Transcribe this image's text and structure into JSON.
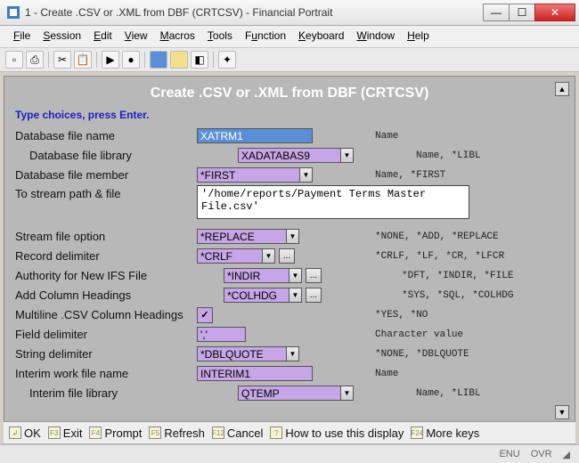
{
  "window": {
    "title": "1 - Create .CSV or .XML from DBF (CRTCSV) - Financial Portrait"
  },
  "menu": {
    "items": [
      "File",
      "Session",
      "Edit",
      "View",
      "Macros",
      "Tools",
      "Function",
      "Keyboard",
      "Window",
      "Help"
    ]
  },
  "screen": {
    "heading": "Create .CSV or .XML from DBF (CRTCSV)",
    "prompt": "Type choices, press Enter."
  },
  "fields": {
    "db_file": {
      "label": "Database file name",
      "value": "XATRM1",
      "hint": "Name"
    },
    "db_lib": {
      "label": "Database file library",
      "value": "XADATABAS9",
      "hint": "Name, *LIBL"
    },
    "db_mbr": {
      "label": "Database file member",
      "value": "*FIRST",
      "hint": "Name, *FIRST"
    },
    "path": {
      "label": "To stream path & file",
      "value": "'/home/reports/Payment Terms Master File.csv'"
    },
    "stmf": {
      "label": "Stream file option",
      "value": "*REPLACE",
      "hint": "*NONE, *ADD, *REPLACE"
    },
    "rcddlm": {
      "label": "Record delimiter",
      "value": "*CRLF",
      "hint": "*CRLF, *LF, *CR, *LFCR"
    },
    "auth": {
      "label": "Authority for New IFS File",
      "value": "*INDIR",
      "hint": "*DFT, *INDIR, *FILE"
    },
    "colhdg": {
      "label": "Add Column Headings",
      "value": "*COLHDG",
      "hint": "*SYS, *SQL, *COLHDG"
    },
    "mline": {
      "label": "Multiline .CSV Column Headings",
      "checked": "✓",
      "hint": "*YES, *NO"
    },
    "flddlm": {
      "label": "Field delimiter",
      "value": "','",
      "hint": "Character value"
    },
    "strdlm": {
      "label": "String delimiter",
      "value": "*DBLQUOTE",
      "hint": "*NONE, *DBLQUOTE"
    },
    "work": {
      "label": "Interim work file name",
      "value": "INTERIM1",
      "hint": "Name"
    },
    "worklib": {
      "label": "Interim file library",
      "value": "QTEMP",
      "hint": "Name, *LIBL"
    }
  },
  "footer": {
    "ok": "OK",
    "exit": "Exit",
    "prompt": "Prompt",
    "refresh": "Refresh",
    "cancel": "Cancel",
    "howto": "How to use this display",
    "more": "More keys"
  },
  "status": {
    "lang": "ENU",
    "ovr": "OVR"
  }
}
